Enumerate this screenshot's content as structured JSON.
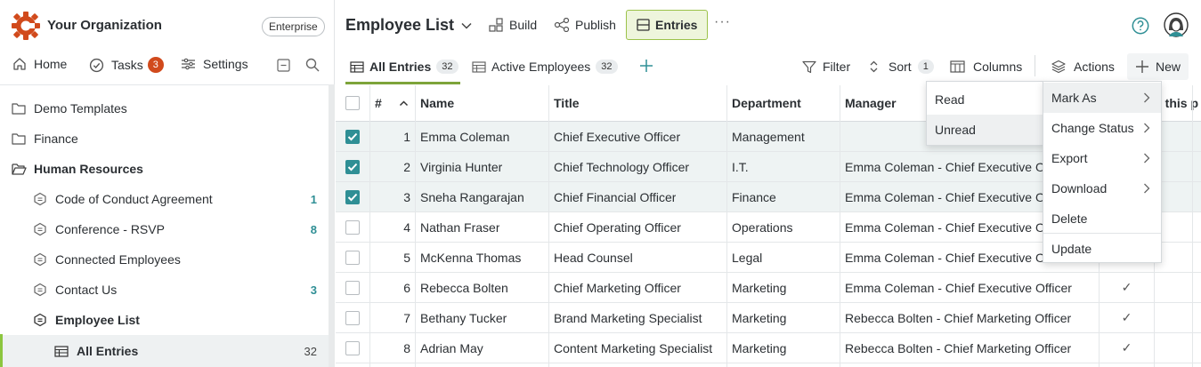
{
  "org": {
    "name": "Your Organization",
    "plan": "Enterprise"
  },
  "nav": {
    "home": "Home",
    "tasks": "Tasks",
    "tasks_count": "3",
    "settings": "Settings"
  },
  "tree": [
    {
      "label": "Demo Templates",
      "icon": "folder-icon",
      "count": ""
    },
    {
      "label": "Finance",
      "icon": "folder-icon",
      "count": ""
    },
    {
      "label": "Human Resources",
      "icon": "folder-open-icon",
      "count": ""
    },
    {
      "label": "Code of Conduct Agreement",
      "icon": "form-icon",
      "count": "1"
    },
    {
      "label": "Conference - RSVP",
      "icon": "form-icon",
      "count": "8"
    },
    {
      "label": "Connected Employees",
      "icon": "form-icon",
      "count": ""
    },
    {
      "label": "Contact Us",
      "icon": "form-icon",
      "count": "3"
    },
    {
      "label": "Employee List",
      "icon": "form-icon",
      "count": ""
    },
    {
      "label": "All Entries",
      "icon": "table-icon",
      "count": "32"
    }
  ],
  "header": {
    "title": "Employee List",
    "build": "Build",
    "publish": "Publish",
    "entries": "Entries",
    "more": "···"
  },
  "tabs": [
    {
      "label": "All Entries",
      "count": "32"
    },
    {
      "label": "Active Employees",
      "count": "32"
    }
  ],
  "toolbar": {
    "filter": "Filter",
    "sort": "Sort",
    "sort_count": "1",
    "columns": "Columns",
    "actions": "Actions",
    "new": "New"
  },
  "table": {
    "columns": {
      "num": "#",
      "name": "Name",
      "title": "Title",
      "department": "Department",
      "manager": "Manager",
      "extra": "s this p"
    },
    "rows": [
      {
        "num": "1",
        "name": "Emma Coleman",
        "title": "Chief Executive Officer",
        "department": "Management",
        "manager": "",
        "selected": true,
        "check": ""
      },
      {
        "num": "2",
        "name": "Virginia Hunter",
        "title": "Chief Technology Officer",
        "department": "I.T.",
        "manager": "Emma Coleman - Chief Executive Officer",
        "selected": true,
        "check": ""
      },
      {
        "num": "3",
        "name": "Sneha Rangarajan",
        "title": "Chief Financial Officer",
        "department": "Finance",
        "manager": "Emma Coleman - Chief Executive Officer",
        "selected": true,
        "check": ""
      },
      {
        "num": "4",
        "name": "Nathan Fraser",
        "title": "Chief Operating Officer",
        "department": "Operations",
        "manager": "Emma Coleman - Chief Executive Officer",
        "selected": false,
        "check": ""
      },
      {
        "num": "5",
        "name": "McKenna Thomas",
        "title": "Head Counsel",
        "department": "Legal",
        "manager": "Emma Coleman - Chief Executive Officer",
        "selected": false,
        "check": ""
      },
      {
        "num": "6",
        "name": "Rebecca Bolten",
        "title": "Chief Marketing Officer",
        "department": "Marketing",
        "manager": "Emma Coleman - Chief Executive Officer",
        "selected": false,
        "check": "✓"
      },
      {
        "num": "7",
        "name": "Bethany Tucker",
        "title": "Brand Marketing Specialist",
        "department": "Marketing",
        "manager": "Rebecca Bolten - Chief Marketing Officer",
        "selected": false,
        "check": "✓"
      },
      {
        "num": "8",
        "name": "Adrian May",
        "title": "Content Marketing Specialist",
        "department": "Marketing",
        "manager": "Rebecca Bolten - Chief Marketing Officer",
        "selected": false,
        "check": "✓"
      }
    ]
  },
  "actions_menu": [
    "Mark As",
    "Change Status",
    "Export",
    "Download",
    "Delete",
    "Update"
  ],
  "mark_as_menu": [
    "Read",
    "Unread"
  ],
  "colors": {
    "accent": "#2f8f95",
    "brand": "#d14a1c",
    "green": "#8cc63f"
  }
}
